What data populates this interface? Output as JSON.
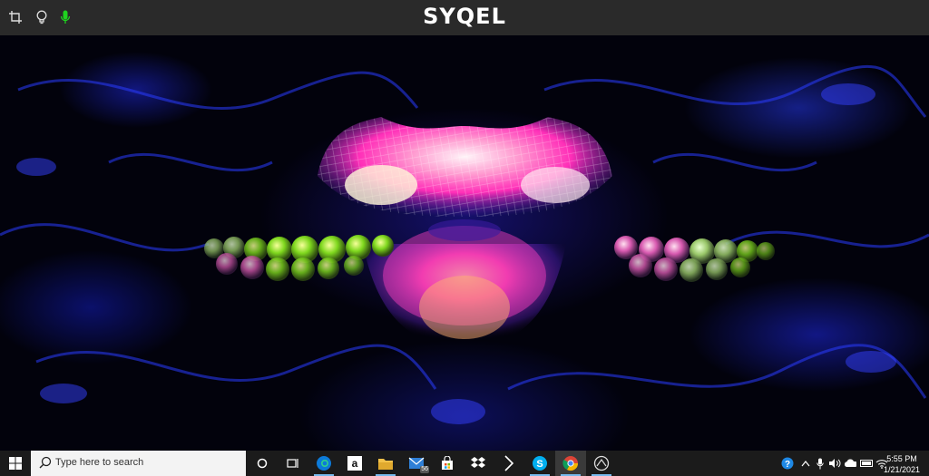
{
  "app": {
    "title": "SYQEL"
  },
  "toolbar": {
    "icons": [
      "crop-icon",
      "lightbulb-icon",
      "microphone-icon"
    ],
    "mic_color": "#1fd31f"
  },
  "taskbar": {
    "search_placeholder": "Type here to search",
    "apps": [
      {
        "name": "task-view-icon"
      },
      {
        "name": "edge-icon"
      },
      {
        "name": "amazon-icon"
      },
      {
        "name": "file-explorer-icon"
      },
      {
        "name": "mail-icon",
        "badge": "56"
      },
      {
        "name": "microsoft-store-icon"
      },
      {
        "name": "dropbox-icon"
      },
      {
        "name": "app-icon"
      },
      {
        "name": "skype-icon"
      },
      {
        "name": "chrome-icon"
      },
      {
        "name": "syqel-app-icon"
      }
    ],
    "tray": [
      "help-icon",
      "chevron-up-icon",
      "microphone-icon",
      "volume-icon",
      "onedrive-icon",
      "battery-icon",
      "wifi-icon"
    ],
    "clock": {
      "time": "5:55 PM",
      "date": "1/21/2021"
    }
  },
  "colors": {
    "topbar": "#2a2a2a",
    "taskbar": "#1b1b1b",
    "accent": "#76b9ed"
  }
}
